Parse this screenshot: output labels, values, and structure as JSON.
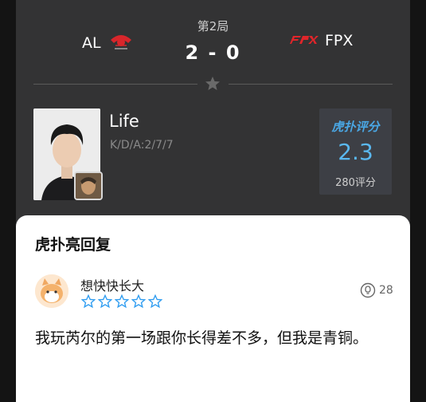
{
  "match": {
    "round": "第2局",
    "score": "2 - 0",
    "team_left": {
      "name": "AL",
      "logo": "al-logo"
    },
    "team_right": {
      "name": "FPX",
      "logo": "fpx-logo"
    }
  },
  "player": {
    "name": "Life",
    "kda": "K/D/A:2/7/7",
    "rating_title": "虎扑评分",
    "rating_score": "2.3",
    "rating_count": "280评分"
  },
  "reply": {
    "heading": "虎扑亮回复",
    "username": "想快快长大",
    "stars_filled": 0,
    "stars_total": 5,
    "likes": "28",
    "comment": "我玩芮尔的第一场跟你长得差不多，但我是青铜。"
  },
  "colors": {
    "accent": "#4aa8e6",
    "card_dark": "#333334",
    "star_outline": "#2e9cf0"
  }
}
